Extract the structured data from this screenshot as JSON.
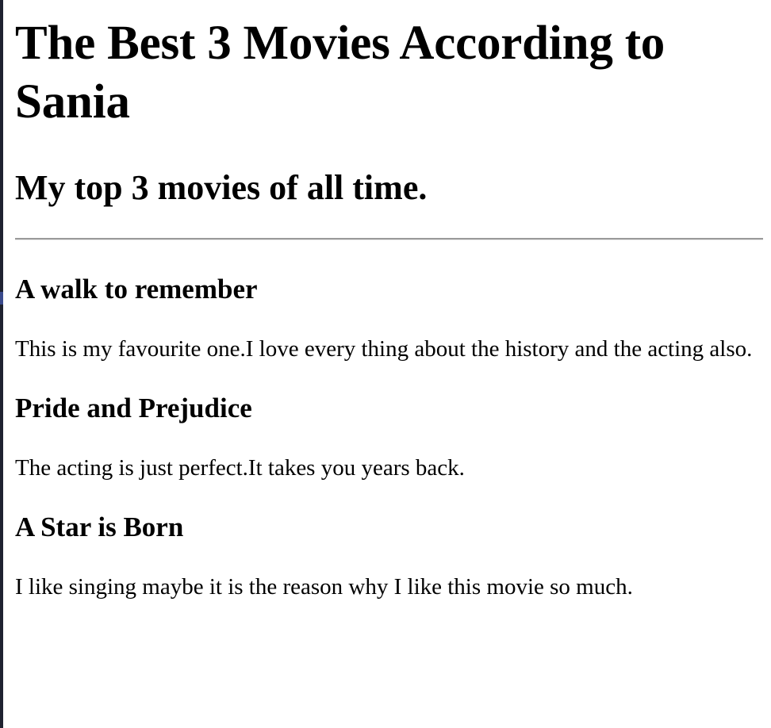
{
  "page": {
    "title": "The Best 3 Movies According to Sania",
    "subtitle": "My top 3 movies of all time."
  },
  "movies": [
    {
      "title": "A walk to remember",
      "description": "This is my favourite one.I love every thing about the history and the acting also."
    },
    {
      "title": "Pride and Prejudice",
      "description": "The acting is just perfect.It takes you years back."
    },
    {
      "title": "A Star is Born",
      "description": "I like singing maybe it is the reason why I like this movie so much."
    }
  ]
}
